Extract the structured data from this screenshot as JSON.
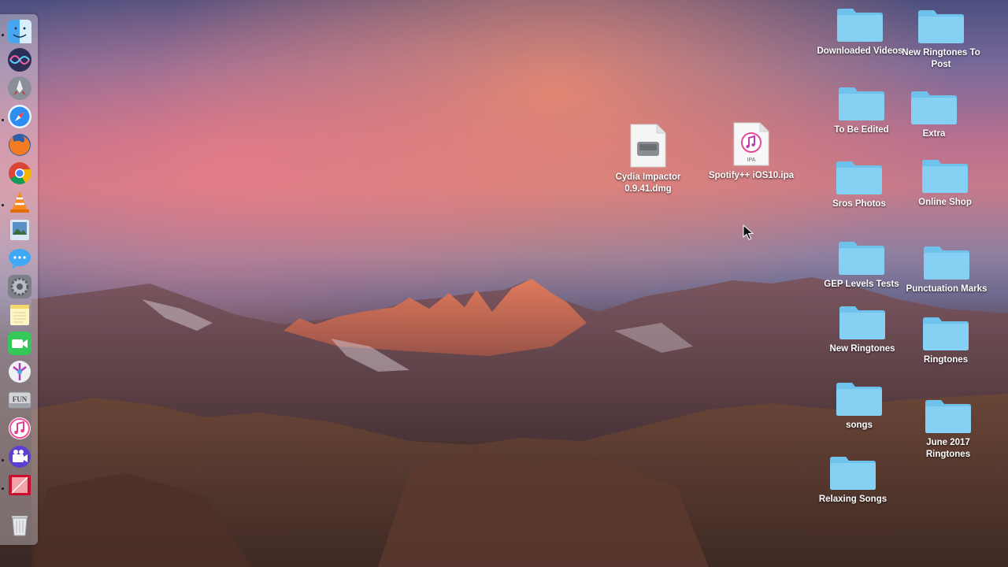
{
  "dock": {
    "items": [
      {
        "name": "Finder",
        "icon": "finder-icon",
        "running": true
      },
      {
        "name": "Siri",
        "icon": "siri-icon",
        "running": false
      },
      {
        "name": "Launchpad",
        "icon": "launchpad-icon",
        "running": false
      },
      {
        "name": "Safari",
        "icon": "safari-icon",
        "running": true
      },
      {
        "name": "Firefox",
        "icon": "firefox-icon",
        "running": false
      },
      {
        "name": "Chrome",
        "icon": "chrome-icon",
        "running": false
      },
      {
        "name": "VLC",
        "icon": "vlc-icon",
        "running": true
      },
      {
        "name": "Preview",
        "icon": "preview-icon",
        "running": false
      },
      {
        "name": "Messages",
        "icon": "messages-icon",
        "running": false
      },
      {
        "name": "System Preferences",
        "icon": "system-preferences-icon",
        "running": false
      },
      {
        "name": "Notes",
        "icon": "notes-icon",
        "running": false
      },
      {
        "name": "FaceTime",
        "icon": "facetime-icon",
        "running": false
      },
      {
        "name": "Instruments",
        "icon": "instruments-icon",
        "running": false
      },
      {
        "name": "FUN Drive",
        "icon": "drive-icon",
        "running": false
      },
      {
        "name": "iTunes",
        "icon": "itunes-icon",
        "running": false
      },
      {
        "name": "iMovie",
        "icon": "imovie-icon",
        "running": true
      },
      {
        "name": "Photo Booth",
        "icon": "photo-booth-icon",
        "running": true
      },
      {
        "name": "Trash",
        "icon": "trash-icon",
        "running": false
      }
    ],
    "drive_label": "FUN",
    "ipa_label": "IPA"
  },
  "desktop": {
    "files": [
      {
        "label": "Cydia Impactor 0.9.41.dmg",
        "icon": "disk-image-icon"
      },
      {
        "label": "Spotify++ iOS10.ipa",
        "icon": "ipa-file-icon"
      }
    ],
    "folders": [
      {
        "label": "Downloaded Videos"
      },
      {
        "label": "New Ringtones To Post"
      },
      {
        "label": "To Be Edited"
      },
      {
        "label": "Extra"
      },
      {
        "label": "Sros Photos"
      },
      {
        "label": "Online Shop"
      },
      {
        "label": "GEP Levels Tests"
      },
      {
        "label": "Punctuation Marks"
      },
      {
        "label": "New Ringtones"
      },
      {
        "label": "Ringtones"
      },
      {
        "label": "songs"
      },
      {
        "label": "June 2017 Ringtones"
      },
      {
        "label": "Relaxing Songs"
      }
    ]
  },
  "colors": {
    "folder": "#7fcdf2",
    "folder_tab": "#6ec2ec",
    "label": "#ffffff"
  }
}
